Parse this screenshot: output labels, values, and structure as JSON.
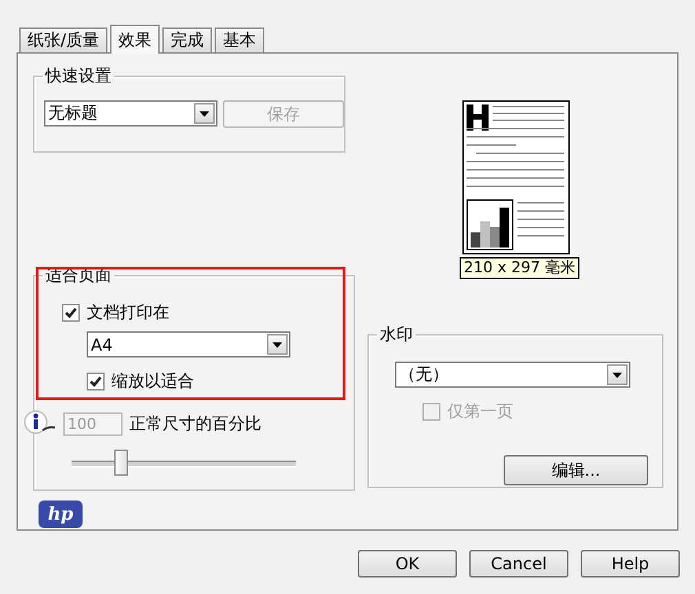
{
  "tabs": [
    {
      "label": "纸张/质量",
      "selected": false
    },
    {
      "label": "效果",
      "selected": true
    },
    {
      "label": "完成",
      "selected": false
    },
    {
      "label": "基本",
      "selected": false
    }
  ],
  "quick_settings": {
    "title": "快速设置",
    "dropdown": {
      "value": "无标题"
    },
    "save_button": {
      "label": "保存",
      "disabled": true
    }
  },
  "fit_to_page": {
    "title": "适合页面",
    "print_on": {
      "label": "文档打印在",
      "checked": true
    },
    "paper": {
      "value": "A4"
    },
    "scale_to_fit": {
      "label": "缩放以适合",
      "checked": true
    }
  },
  "percent": {
    "value": "100",
    "disabled": true,
    "label": "正常尺寸的百分比",
    "level": 0.22
  },
  "preview": {
    "size_label": "210 x 297 毫米"
  },
  "watermark": {
    "title": "水印",
    "dropdown": {
      "value": "（无）"
    },
    "first_page_only": {
      "label": "仅第一页",
      "checked": false,
      "disabled": true
    },
    "edit_button": {
      "label": "编辑..."
    }
  },
  "logo": "hp",
  "buttons": [
    "OK",
    "Cancel",
    "Help"
  ]
}
